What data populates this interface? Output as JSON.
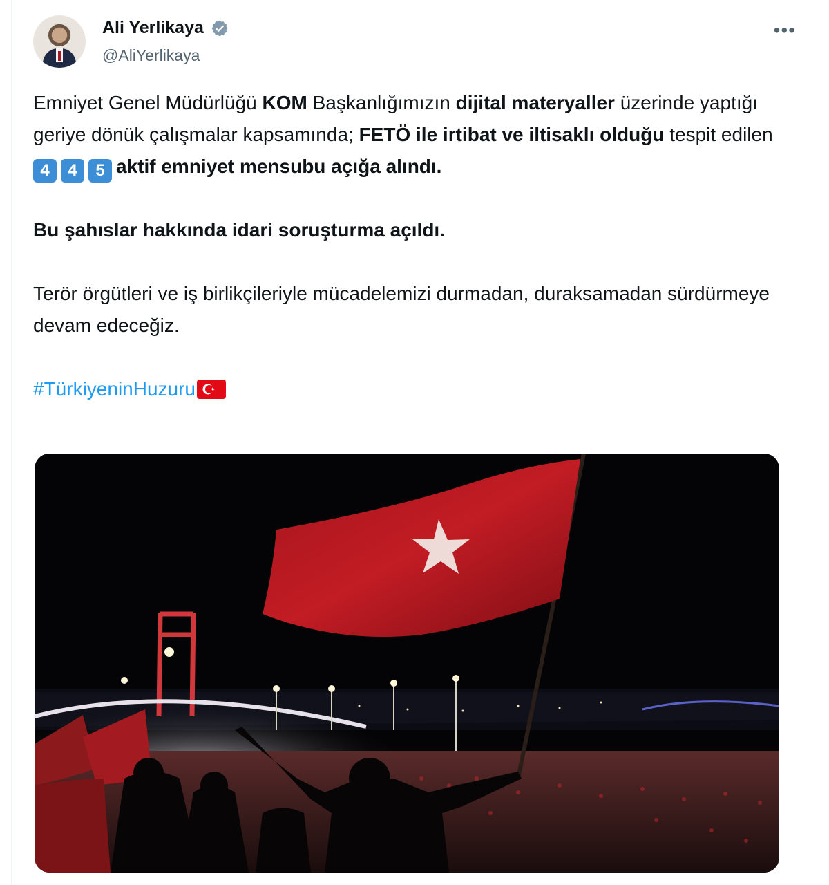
{
  "author": {
    "display_name": "Ali Yerlikaya",
    "handle": "@AliYerlikaya",
    "verified": true,
    "avatar_icon": "profile-photo"
  },
  "tweet": {
    "p1": {
      "s1": "Emniyet Genel Müdürlüğü ",
      "s2": "KOM",
      "s3": " Başkanlığımızın ",
      "s4": "dijital materyaller",
      "s5": " üzerinde yaptığı geriye dönük çalışmalar kapsamında; ",
      "s6": "FETÖ ile irtibat ve iltisaklı olduğu",
      "s7": " tespit edilen ",
      "digits": [
        "4",
        "4",
        "5"
      ],
      "s8": "aktif emniyet mensubu açığa alındı."
    },
    "p2": "Bu şahıslar hakkında idari soruşturma açıldı.",
    "p3": "Terör örgütleri ve iş birlikçileriyle mücadelemizi durmadan, duraksamadan sürdürmeye devam edeceğiz.",
    "hashtag": "#TürkiyeninHuzuru",
    "hashtag_emoji": "turkey-flag-icon"
  },
  "media": {
    "description_icon": "night-bridge-crowd-flag-photo"
  },
  "colors": {
    "hashtag": "#1d9bf0",
    "keycap": "#3c8ed6",
    "flag_red": "#c8102e",
    "verified": "#829aab"
  },
  "more_icon": "ellipsis-icon"
}
